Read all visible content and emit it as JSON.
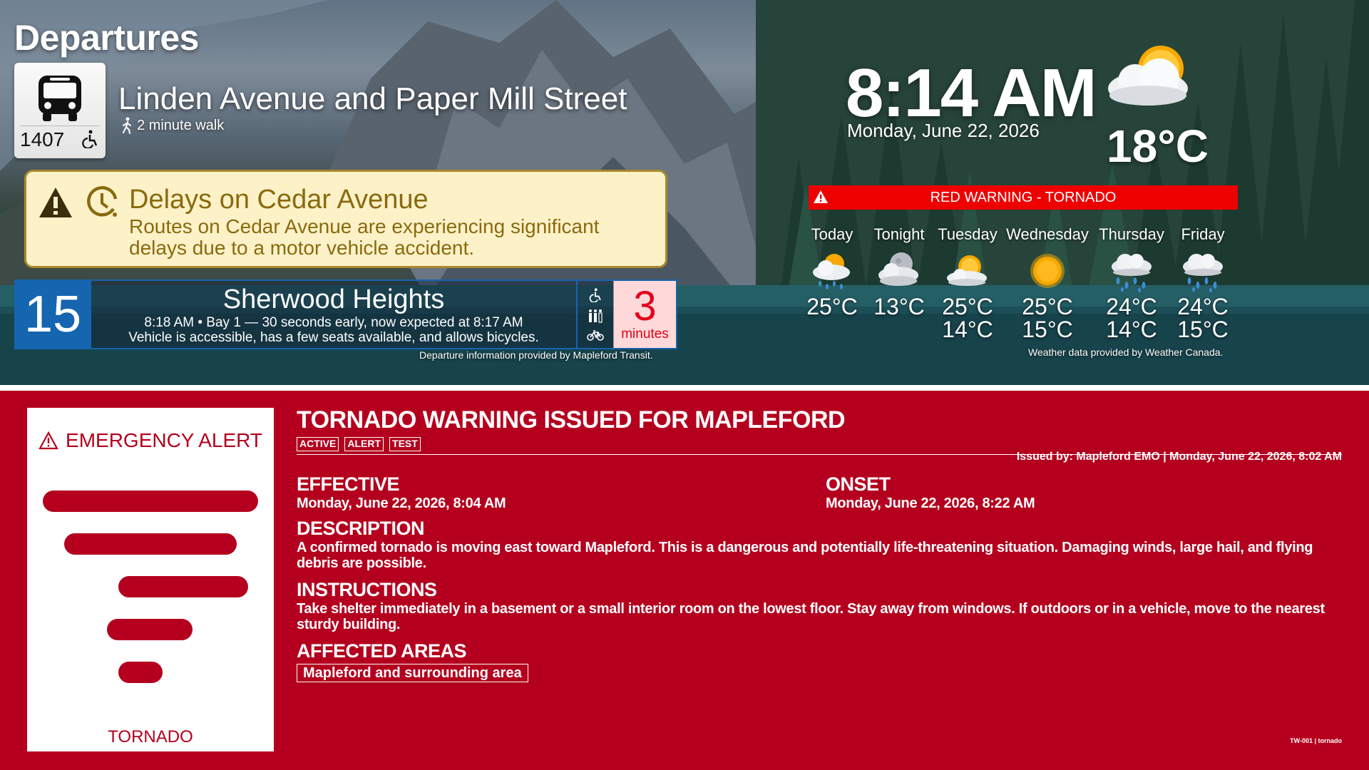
{
  "departures": {
    "title": "Departures",
    "stop": {
      "number": "1407",
      "name": "Linden Avenue and Paper Mill Street",
      "walk": "2 minute walk"
    },
    "service_alert": {
      "title": "Delays on Cedar Avenue",
      "body": "Routes on Cedar Avenue are experiencing significant delays due to a motor vehicle accident."
    },
    "route": {
      "number": "15",
      "destination": "Sherwood Heights",
      "detail_line1": "8:18 AM • Bay 1 — 30 seconds early, now expected at 8:17 AM",
      "detail_line2": "Vehicle is accessible, has a few seats available, and allows bicycles.",
      "eta_value": "3",
      "eta_unit": "minutes"
    },
    "credit": "Departure information provided by Mapleford Transit."
  },
  "clock": {
    "time": "8:14 AM",
    "date": "Monday, June 22, 2026"
  },
  "weather": {
    "current_temp": "18°C",
    "current_icon": "cloudy-sun-icon",
    "warning": "RED WARNING - TORNADO",
    "forecast": [
      {
        "day": "Today",
        "icon": "rain-sun-icon",
        "high": "25°C",
        "low": ""
      },
      {
        "day": "Tonight",
        "icon": "cloudy-moon-icon",
        "high": "13°C",
        "low": ""
      },
      {
        "day": "Tuesday",
        "icon": "cloudy-sun-icon",
        "high": "25°C",
        "low": "14°C"
      },
      {
        "day": "Wednesday",
        "icon": "sun-icon",
        "high": "25°C",
        "low": "15°C"
      },
      {
        "day": "Thursday",
        "icon": "rain-icon",
        "high": "24°C",
        "low": "14°C"
      },
      {
        "day": "Friday",
        "icon": "rain-icon",
        "high": "24°C",
        "low": "15°C"
      }
    ],
    "credit": "Weather data provided by Weather Canada."
  },
  "emergency": {
    "card_title": "EMERGENCY ALERT",
    "card_type": "TORNADO",
    "headline": "TORNADO WARNING ISSUED FOR MAPLEFORD",
    "tags": [
      "ACTIVE",
      "ALERT",
      "TEST"
    ],
    "issued": "Issued by: Mapleford EMO | Monday, June 22, 2026, 8:02 AM",
    "effective_label": "EFFECTIVE",
    "effective_value": "Monday, June 22, 2026, 8:04 AM",
    "onset_label": "ONSET",
    "onset_value": "Monday, June 22, 2026, 8:22 AM",
    "description_label": "DESCRIPTION",
    "description": "A confirmed tornado is moving east toward Mapleford. This is a dangerous and potentially life-threatening situation. Damaging winds, large hail, and flying debris are possible.",
    "instructions_label": "INSTRUCTIONS",
    "instructions": "Take shelter immediately in a basement or a small interior room on the lowest floor. Stay away from windows. If outdoors or in a vehicle, move to the nearest sturdy building.",
    "areas_label": "AFFECTED AREAS",
    "areas": [
      "Mapleford and surrounding area"
    ],
    "footer_id": "TW-001 | tornado"
  },
  "colors": {
    "emergency_red": "#b4001e",
    "route_blue": "#1565b0",
    "warning_red": "#ee0000",
    "eta_text": "#e4001b"
  }
}
